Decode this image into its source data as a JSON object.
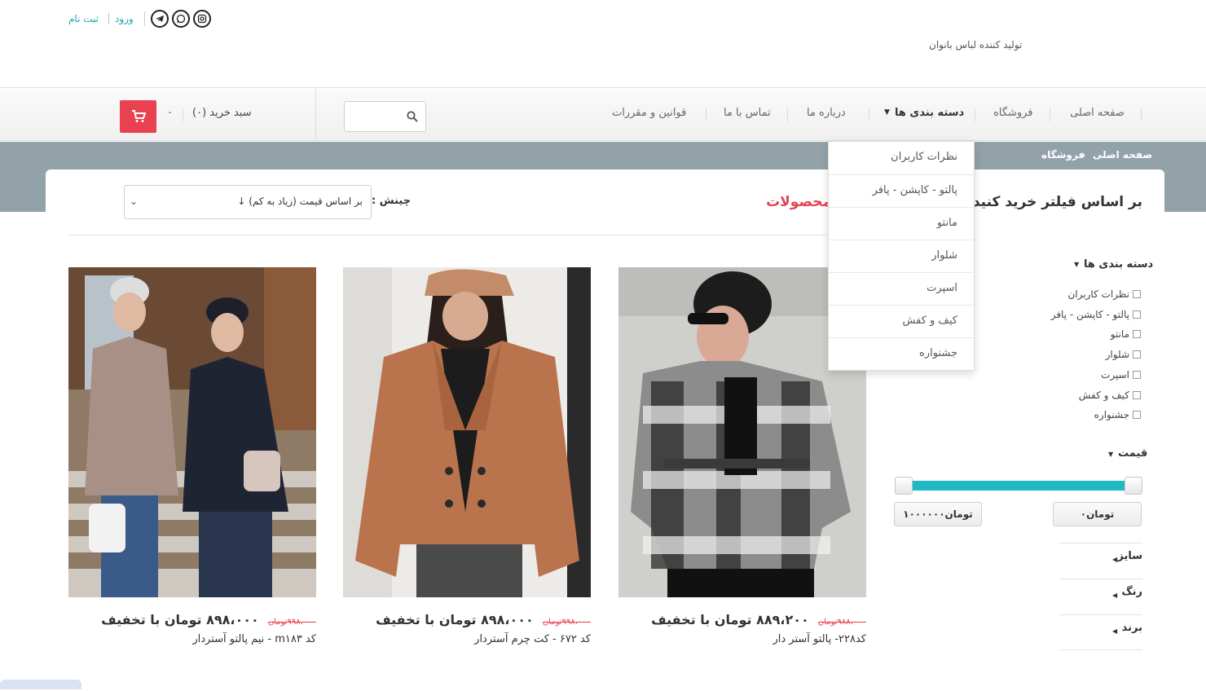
{
  "header": {
    "auth": {
      "register": "ثبت نام",
      "login": "ورود"
    },
    "social_icons": [
      "telegram-icon",
      "whatsapp-icon",
      "instagram-icon"
    ],
    "tagline": "تولید کننده لباس بانوان"
  },
  "nav": {
    "items": [
      "صفحه اصلی",
      "فروشگاه",
      "دسته بندی ها",
      "درباره ما",
      "تماس با ما",
      "قوانین و مقررات"
    ],
    "cart_label": "سبد خرید (۰)",
    "cart_total": "۰",
    "accent": "#e8414f"
  },
  "breadcrumb": {
    "home": "صفحه اصلی",
    "current": "فروشگاه"
  },
  "dropdown": {
    "items": [
      "نظرات کاربران",
      "پالتو - کاپشن - پافر",
      "مانتو",
      "شلوار",
      "اسپرت",
      "کیف و کفش",
      "جشنواره"
    ]
  },
  "filter": {
    "title": "بر اساس فیلتر خرید کنید",
    "categories_heading": "دسته بندی ها",
    "categories": [
      "نظرات کاربران",
      "پالتو - کاپشن - پافر",
      "مانتو",
      "شلوار",
      "اسپرت",
      "کیف و کفش",
      "جشنواره"
    ],
    "price_heading": "قیمت",
    "price_min": "تومان۰",
    "price_max": "تومان۱۰۰۰۰۰۰",
    "slider_accent": "#1fb9c4",
    "rows": [
      "سایز",
      "رنگ",
      "برند"
    ]
  },
  "main": {
    "products_title": "محصولات",
    "sort_label": "چینش :",
    "sort_value": "بر اساس قیمت (زیاد به کم) ↓"
  },
  "products": [
    {
      "old_price": "۹۹۸،۰۰۰تومان",
      "new_price": "۸۹۸،۰۰۰ تومان با تخفیف",
      "name": "کد m۱۸۳ - نیم پالتو آستردار"
    },
    {
      "old_price": "۹۹۸،۰۰۰تومان",
      "new_price": "۸۹۸،۰۰۰ تومان با تخفیف",
      "name": "کد ۶۷۲ - کت چرم آستردار"
    },
    {
      "old_price": "۹۸۸،۰۰۰تومان",
      "new_price": "۸۸۹،۲۰۰ تومان با تخفیف",
      "name": "کد۲۲۸- پالتو آستر دار"
    }
  ]
}
